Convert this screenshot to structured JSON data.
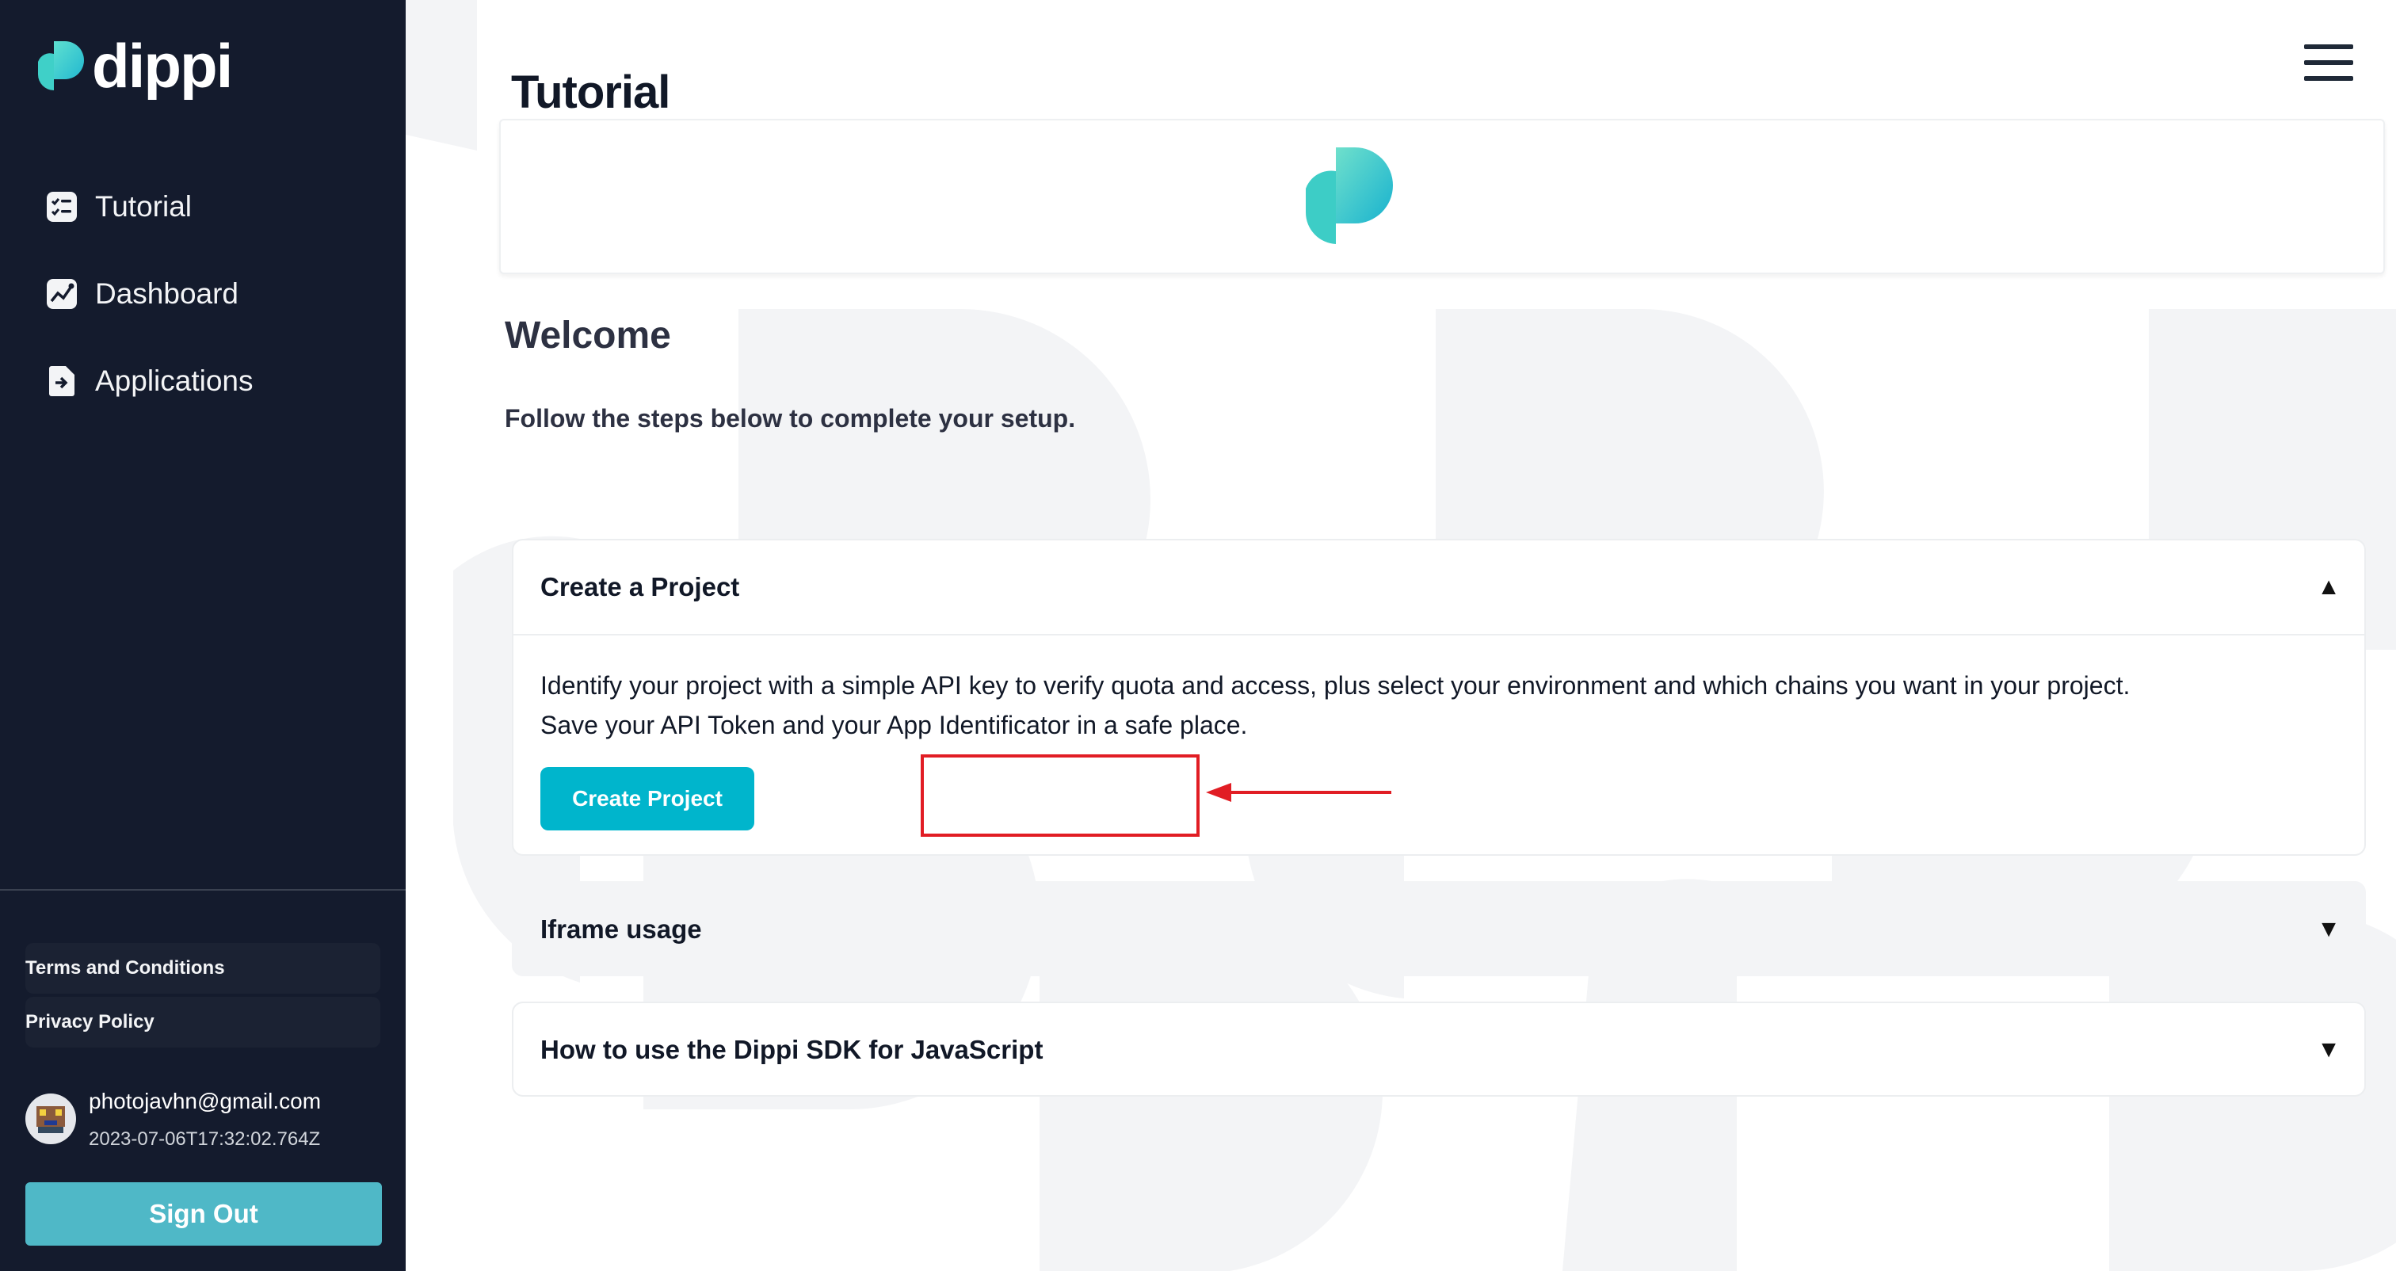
{
  "brand": {
    "name": "dippi",
    "accent": "#00b5cc",
    "sidebar_bg": "#141b2d"
  },
  "sidebar": {
    "items": [
      {
        "label": "Tutorial",
        "icon": "checklist-icon"
      },
      {
        "label": "Dashboard",
        "icon": "chart-icon"
      },
      {
        "label": "Applications",
        "icon": "file-arrow-icon"
      }
    ],
    "legal": {
      "terms": "Terms and Conditions",
      "privacy": "Privacy Policy"
    },
    "user": {
      "email": "photojavhn@gmail.com",
      "timestamp": "2023-07-06T17:32:02.764Z"
    },
    "sign_out": "Sign Out"
  },
  "header": {
    "title": "Tutorial",
    "menu_icon": "hamburger-menu-icon"
  },
  "main": {
    "welcome": "Welcome",
    "subtitle": "Follow the steps below to complete your setup.",
    "panels": [
      {
        "title": "Create a Project",
        "caret": "▲",
        "expanded": true,
        "body": [
          "Identify your project with a simple API key to verify quota and access, plus select your environment and which chains you want in your project.",
          "Save your API Token and your App Identificator in a safe place."
        ],
        "button": "Create Project"
      },
      {
        "title": "Iframe usage",
        "caret": "▼",
        "expanded": false
      },
      {
        "title": "How to use the Dippi SDK for JavaScript",
        "caret": "▼",
        "expanded": false
      }
    ]
  },
  "annotation": {
    "color": "#e11d24"
  }
}
